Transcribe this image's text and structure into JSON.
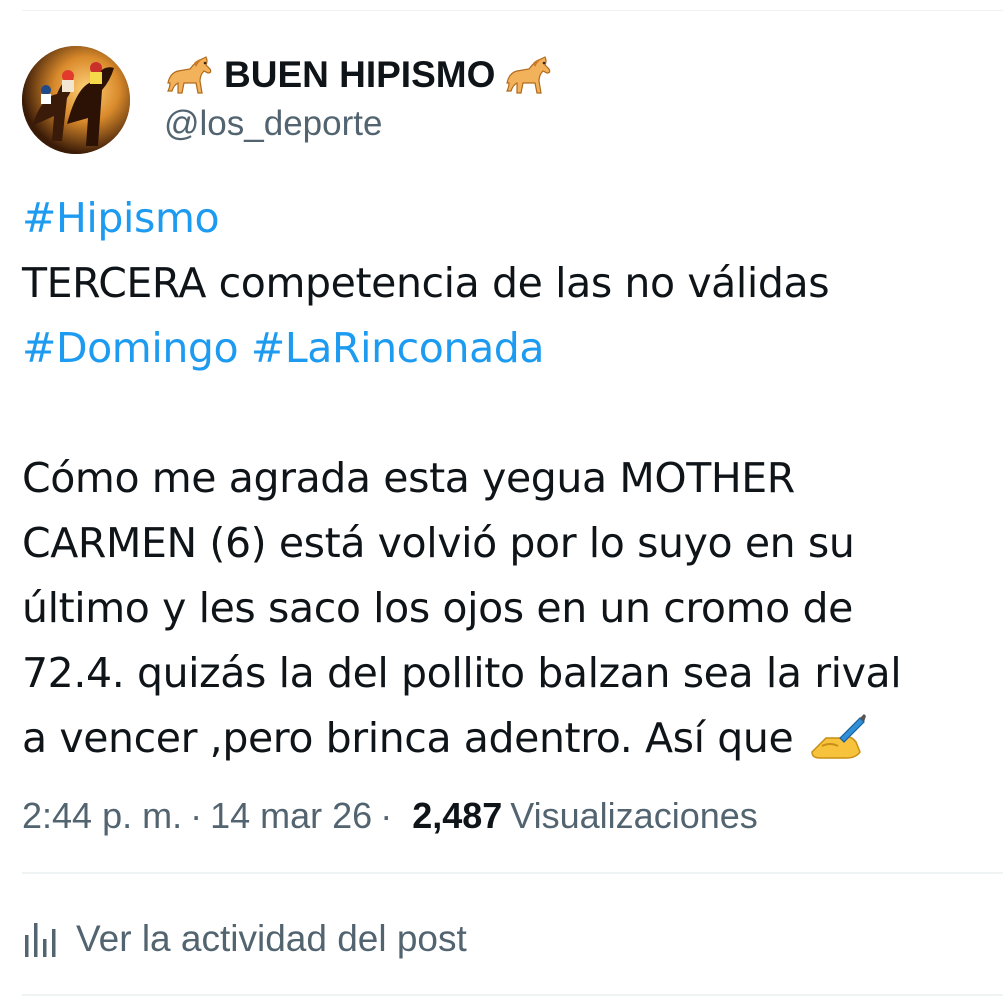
{
  "author": {
    "display_name": "BUEN HIPISMO",
    "handle": "@los_deporte",
    "name_emoji_left": "horse-emoji",
    "name_emoji_right": "horse-emoji",
    "avatar": "horse-racing-photo"
  },
  "tweet": {
    "lines": [
      {
        "parts": [
          {
            "text": "#Hipismo",
            "hashtag": true
          }
        ]
      },
      {
        "parts": [
          {
            "text": "TERCERA competencia de las no válidas",
            "hashtag": false
          }
        ]
      },
      {
        "parts": [
          {
            "text": "#Domingo",
            "hashtag": true
          },
          {
            "text": " ",
            "hashtag": false
          },
          {
            "text": "#LaRinconada",
            "hashtag": true
          }
        ]
      },
      {
        "parts": []
      },
      {
        "parts": [
          {
            "text": "Cómo me agrada esta yegua MOTHER",
            "hashtag": false
          }
        ]
      },
      {
        "parts": [
          {
            "text": "CARMEN (6) está volvió por lo suyo en su",
            "hashtag": false
          }
        ]
      },
      {
        "parts": [
          {
            "text": "último y les saco los ojos en un cromo de",
            "hashtag": false
          }
        ]
      },
      {
        "parts": [
          {
            "text": "72.4. quizás la del pollito balzan sea la rival",
            "hashtag": false
          }
        ]
      },
      {
        "parts": [
          {
            "text": "a vencer ,pero brinca adentro. Así que ",
            "hashtag": false
          }
        ]
      }
    ],
    "trailing_emoji": "writing-hand-emoji"
  },
  "meta": {
    "time": "2:44 p. m.",
    "separator": "·",
    "date": "14 mar 26",
    "views_count": "2,487",
    "views_label": "Visualizaciones"
  },
  "activity": {
    "label": "Ver la actividad del post",
    "icon": "analytics-bars-icon"
  },
  "colors": {
    "hashtag": "#1d9bf0",
    "text": "#0f1419",
    "secondary": "#536471",
    "divider": "#eff3f4"
  }
}
